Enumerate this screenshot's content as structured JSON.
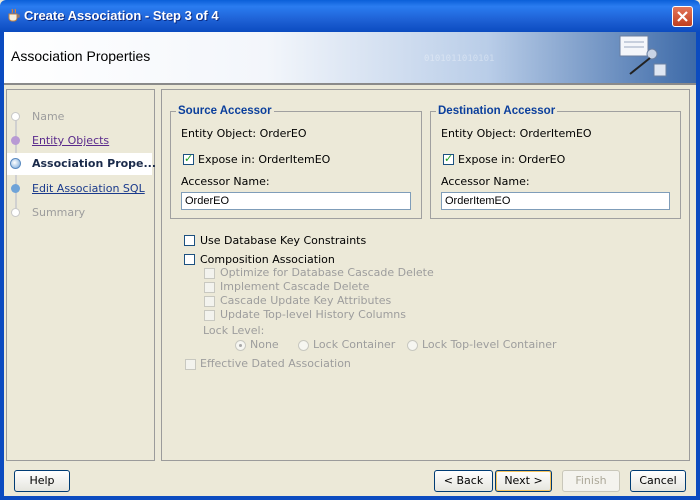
{
  "window": {
    "title": "Create Association - Step 3 of 4",
    "icon": "coffee-cup-icon"
  },
  "header": {
    "title": "Association Properties",
    "watermark": "0101011010101"
  },
  "nav": {
    "items": [
      {
        "label": "Name",
        "state": "disabled"
      },
      {
        "label": "Entity Objects",
        "state": "link"
      },
      {
        "label": "Association Prope...",
        "state": "current"
      },
      {
        "label": "Edit Association SQL",
        "state": "link"
      },
      {
        "label": "Summary",
        "state": "disabled"
      }
    ]
  },
  "source": {
    "title": "Source Accessor",
    "entity_object": "Entity Object: OrderEO",
    "expose_label": "Expose in: OrderItemEO",
    "expose_checked": true,
    "accessor_name_label": "Accessor Name:",
    "accessor_name_value": "OrderEO"
  },
  "destination": {
    "title": "Destination Accessor",
    "entity_object": "Entity Object: OrderItemEO",
    "expose_label": "Expose in: OrderEO",
    "expose_checked": true,
    "accessor_name_label": "Accessor Name:",
    "accessor_name_value": "OrderItemEO"
  },
  "options": {
    "use_db_key": "Use Database Key Constraints",
    "composition": "Composition Association",
    "optimize": "Optimize for Database Cascade Delete",
    "implement_cascade": "Implement Cascade Delete",
    "cascade_update": "Cascade Update Key Attributes",
    "update_history": "Update Top-level History Columns",
    "lock_level_label": "Lock Level:",
    "lock_none": "None",
    "lock_container": "Lock Container",
    "lock_top": "Lock Top-level Container",
    "effective_dated": "Effective Dated Association"
  },
  "buttons": {
    "help": "Help",
    "back": "< Back",
    "next": "Next >",
    "finish": "Finish",
    "cancel": "Cancel"
  },
  "colors": {
    "title_bar": "#0b4bc0",
    "group_title": "#0b3f9c",
    "nav_link": "#1a3a8c",
    "checkmark": "#21a121"
  }
}
